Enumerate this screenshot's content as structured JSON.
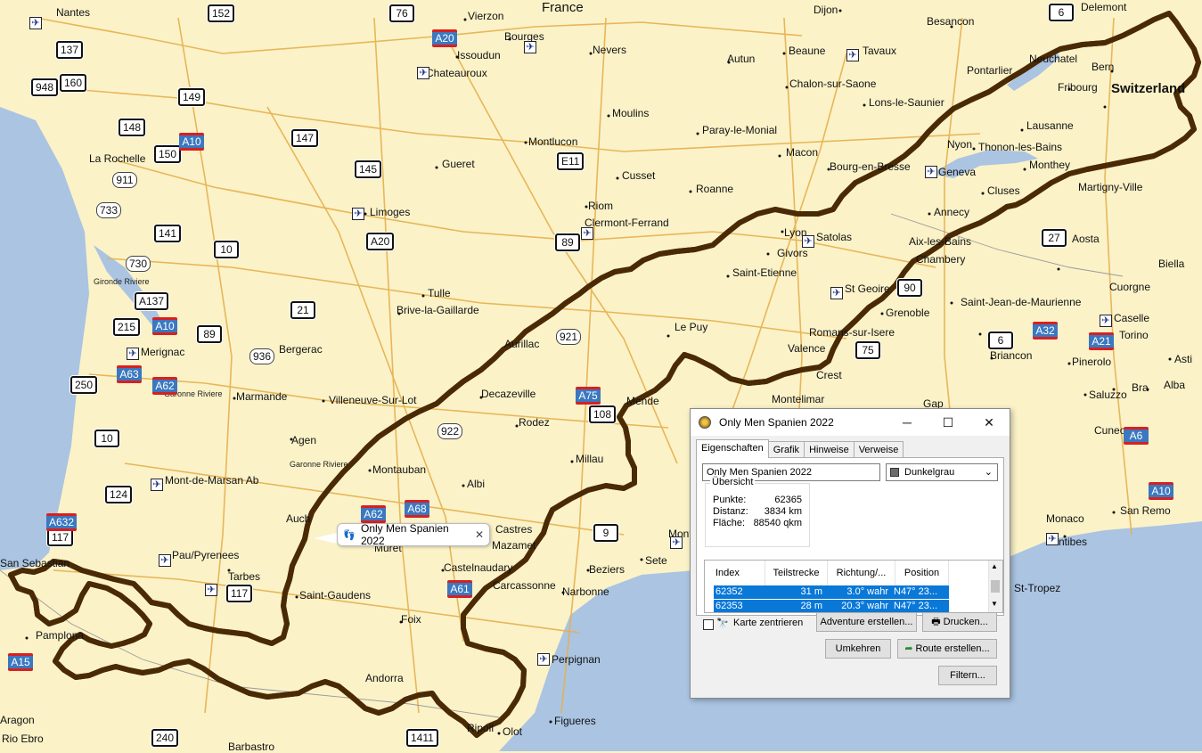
{
  "map": {
    "countries": [
      "France",
      "Switzerland"
    ],
    "cities": [
      "Nantes",
      "Vierzon",
      "Bourges",
      "Issoudun",
      "Chateauroux",
      "Nevers",
      "Dijon",
      "Besancon",
      "Delemont",
      "Beaune",
      "Tavaux",
      "Autun",
      "Chalon-sur-Saone",
      "Lons-le-Saunier",
      "Pontarlier",
      "Neuchatel",
      "Bern",
      "Fribourg",
      "Lausanne",
      "Nyon",
      "Thonon-les-Bains",
      "Monthey",
      "Martigny-Ville",
      "Geneva",
      "Cluses",
      "Annecy",
      "Aosta",
      "Biella",
      "Cuorgne",
      "Aix-les-Bains",
      "Chambery",
      "Saint-Jean-de-Maurienne",
      "Caselle",
      "Torino",
      "Pinerolo",
      "Asti",
      "Alba",
      "Bra",
      "Saluzzo",
      "Cuneo",
      "Moulins",
      "Paray-le-Monial",
      "Macon",
      "Bourg-en-Bresse",
      "Montlucon",
      "Cusset",
      "Roanne",
      "Riom",
      "Clermont-Ferrand",
      "Lyon",
      "Satolas",
      "Givors",
      "Saint-Etienne",
      "St Geoire",
      "Grenoble",
      "Le Puy",
      "Romans-sur-Isere",
      "Valence",
      "Crest",
      "Briancon",
      "Montelimar",
      "Gap",
      "La Rochelle",
      "Gueret",
      "Limoges",
      "Tulle",
      "Brive-la-Gaillarde",
      "Aurillac",
      "Decazeville",
      "Rodez",
      "Millau",
      "Mende",
      "Bergerac",
      "Merignac",
      "Marmande",
      "Villeneuve-Sur-Lot",
      "Agen",
      "Montauban",
      "Albi",
      "Castres",
      "Mazamet",
      "Castelnaudary",
      "Carcassonne",
      "Narbonne",
      "Beziers",
      "Sete",
      "Montpellier",
      "Perpignan",
      "Figueres",
      "Olot",
      "Ripoll",
      "Andorra",
      "Foix",
      "Saint-Gaudens",
      "Tarbes",
      "Pau/Pyrenees",
      "Mont-de-Marsan Ab",
      "Auch",
      "Muret",
      "Pamplona",
      "San Sebastian",
      "Aragon",
      "Rio Ebro",
      "Barbastro",
      "Monaco",
      "San Remo",
      "Antibes",
      "St-Tropez"
    ],
    "small_labels": [
      "Gironde Riviere",
      "Garonne Riviere",
      "Garonne Riviere"
    ],
    "route_color": "#e08a1a",
    "tooltip": "Only Men Spanien 2022",
    "tooltip_close": "✕"
  },
  "shields": [
    {
      "t": "152",
      "k": "black"
    },
    {
      "t": "76",
      "k": "black"
    },
    {
      "t": "6",
      "k": "black"
    },
    {
      "t": "137",
      "k": "black"
    },
    {
      "t": "948",
      "k": "black"
    },
    {
      "t": "160",
      "k": "black"
    },
    {
      "t": "149",
      "k": "black"
    },
    {
      "t": "148",
      "k": "black"
    },
    {
      "t": "147",
      "k": "black"
    },
    {
      "t": "150",
      "k": "black"
    },
    {
      "t": "911",
      "k": "white"
    },
    {
      "t": "733",
      "k": "white"
    },
    {
      "t": "145",
      "k": "black"
    },
    {
      "t": "E11",
      "k": "black"
    },
    {
      "t": "141",
      "k": "black"
    },
    {
      "t": "10",
      "k": "black"
    },
    {
      "t": "A20",
      "k": "black"
    },
    {
      "t": "89",
      "k": "black"
    },
    {
      "t": "730",
      "k": "white"
    },
    {
      "t": "A137",
      "k": "black"
    },
    {
      "t": "21",
      "k": "black"
    },
    {
      "t": "215",
      "k": "black"
    },
    {
      "t": "89",
      "k": "black"
    },
    {
      "t": "936",
      "k": "white"
    },
    {
      "t": "921",
      "k": "white"
    },
    {
      "t": "90",
      "k": "black"
    },
    {
      "t": "27",
      "k": "black"
    },
    {
      "t": "75",
      "k": "black"
    },
    {
      "t": "6",
      "k": "black"
    },
    {
      "t": "250",
      "k": "black"
    },
    {
      "t": "10",
      "k": "black"
    },
    {
      "t": "922",
      "k": "white"
    },
    {
      "t": "124",
      "k": "black"
    },
    {
      "t": "117",
      "k": "black"
    },
    {
      "t": "9",
      "k": "black"
    },
    {
      "t": "117",
      "k": "black"
    },
    {
      "t": "108",
      "k": "black"
    },
    {
      "t": "240",
      "k": "black"
    },
    {
      "t": "1411",
      "k": "black"
    },
    {
      "t": "A20",
      "k": "blue"
    },
    {
      "t": "A10",
      "k": "blue"
    },
    {
      "t": "A10",
      "k": "blue"
    },
    {
      "t": "A63",
      "k": "blue"
    },
    {
      "t": "A62",
      "k": "blue"
    },
    {
      "t": "A75",
      "k": "blue"
    },
    {
      "t": "A62",
      "k": "blue"
    },
    {
      "t": "A68",
      "k": "blue"
    },
    {
      "t": "A61",
      "k": "blue"
    },
    {
      "t": "A632",
      "k": "blue"
    },
    {
      "t": "A15",
      "k": "blue"
    },
    {
      "t": "A32",
      "k": "blue"
    },
    {
      "t": "A21",
      "k": "blue"
    },
    {
      "t": "A6",
      "k": "blue"
    },
    {
      "t": "A10",
      "k": "blue"
    }
  ],
  "dialog": {
    "title": "Only Men Spanien 2022",
    "minimize": "─",
    "maximize": "☐",
    "close": "✕",
    "tabs": [
      "Eigenschaften",
      "Grafik",
      "Hinweise",
      "Verweise"
    ],
    "name_value": "Only Men Spanien 2022",
    "color_value": "Dunkelgrau",
    "color_swatch": "#6b6b6b",
    "overview_legend": "Übersicht",
    "stats": [
      {
        "label": "Punkte:",
        "value": "62365"
      },
      {
        "label": "Distanz:",
        "value": "3834 km"
      },
      {
        "label": "Fläche:",
        "value": "88540 qkm"
      }
    ],
    "columns": [
      "Index",
      "Teilstrecke",
      "Richtung/...",
      "Position"
    ],
    "rows": [
      {
        "index": "62352",
        "segment": "31 m",
        "direction": "3.0° wahr",
        "position": "N47° 23..."
      },
      {
        "index": "62353",
        "segment": "28 m",
        "direction": "20.3° wahr",
        "position": "N47° 23..."
      }
    ],
    "checkbox_label": "Karte zentrieren",
    "buttons": {
      "adventure": "Adventure erstellen...",
      "print": "Drucken...",
      "reverse": "Umkehren",
      "route": "Route erstellen...",
      "filter": "Filtern..."
    }
  }
}
